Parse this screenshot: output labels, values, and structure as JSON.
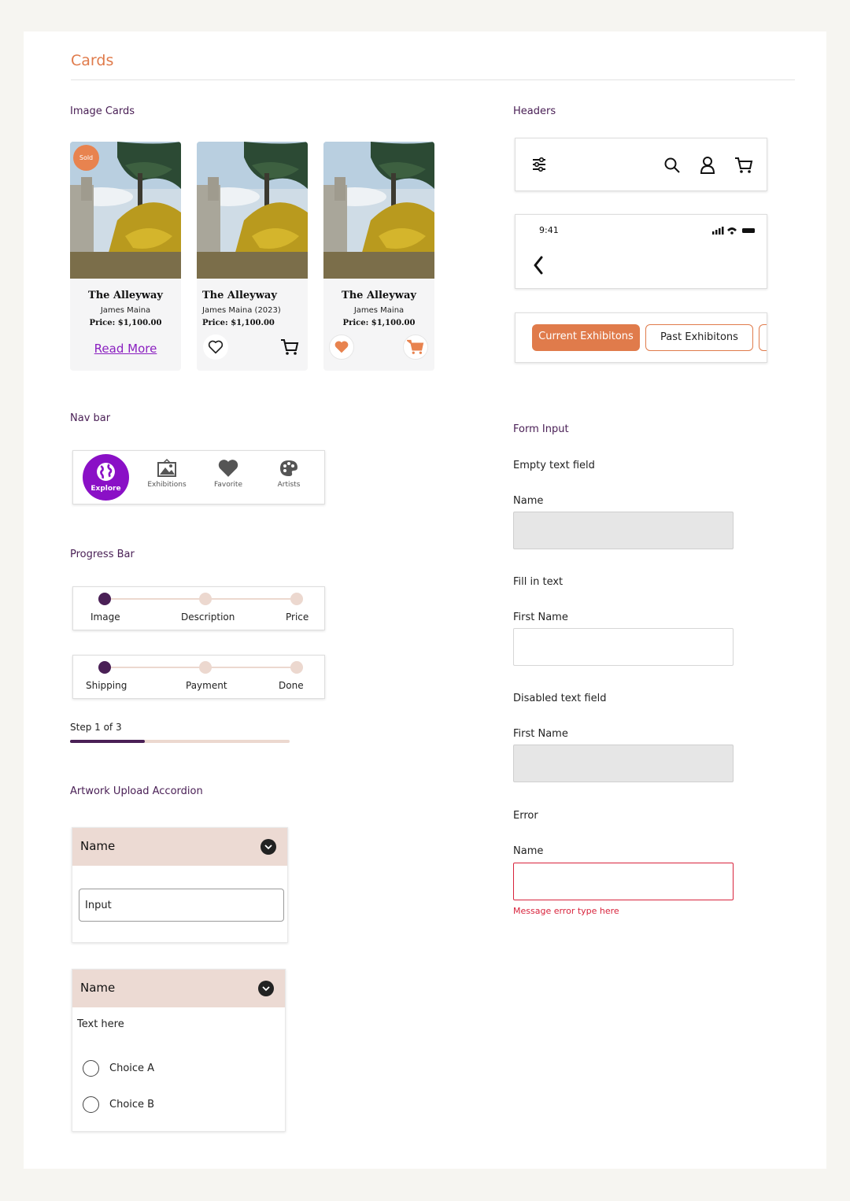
{
  "page": {
    "title": "Cards"
  },
  "sections": {
    "image_cards": "Image Cards",
    "headers": "Headers",
    "nav_bar": "Nav bar",
    "form_input": "Form Input",
    "progress_bar": "Progress Bar",
    "accordion": "Artwork Upload Accordion"
  },
  "cards": [
    {
      "badge": "Sold",
      "title": "The Alleyway",
      "artist": "James Maina",
      "price": "Price: $1,100.00",
      "link": "Read More"
    },
    {
      "title": "The Alleyway",
      "artist": "James Maina (2023)",
      "price": "Price: $1,100.00",
      "favorite_icon": "heart-outline-icon",
      "cart_icon": "cart-icon"
    },
    {
      "title": "The Alleyway",
      "artist": "James Maina",
      "price": "Price: $1,100.00",
      "favorite_icon": "heart-filled-icon",
      "cart_icon": "cart-filled-icon",
      "active_color": "#e8834f"
    }
  ],
  "header_bar": {
    "icons": [
      "filter-icon",
      "search-icon",
      "user-icon",
      "cart-icon"
    ]
  },
  "mobile_header": {
    "time": "9:41",
    "back_icon": "chevron-left-icon"
  },
  "tabs": {
    "active": "Current Exhibitons",
    "inactive": "Past Exhibitons",
    "accent": "#e07b4b"
  },
  "nav": {
    "items": [
      {
        "label": "Explore",
        "icon": "globe-icon",
        "active": true
      },
      {
        "label": "Exhibitions",
        "icon": "image-icon"
      },
      {
        "label": "Favorite",
        "icon": "heart-icon"
      },
      {
        "label": "Artists",
        "icon": "palette-icon"
      }
    ],
    "active_color": "#8a10c6"
  },
  "progress": {
    "stepper1": [
      "Image",
      "Description",
      "Price"
    ],
    "stepper2": [
      "Shipping",
      "Payment",
      "Done"
    ],
    "step_text": "Step 1 of 3",
    "step_fraction": 0.34,
    "active_color": "#4a2056",
    "inactive_color": "#ecd8cf"
  },
  "accordion": {
    "first": {
      "title": "Name",
      "input_value": "Input"
    },
    "second": {
      "title": "Name",
      "text": "Text here",
      "choices": [
        "Choice A",
        "Choice B"
      ]
    }
  },
  "form": {
    "empty": {
      "heading": "Empty text field",
      "label": "Name"
    },
    "fill": {
      "heading": "Fill in text",
      "label": "First Name"
    },
    "disabled": {
      "heading": "Disabled text field",
      "label": "First Name"
    },
    "error": {
      "heading": "Error",
      "label": "Name",
      "message": "Message error type here",
      "color": "#d8233c"
    }
  }
}
